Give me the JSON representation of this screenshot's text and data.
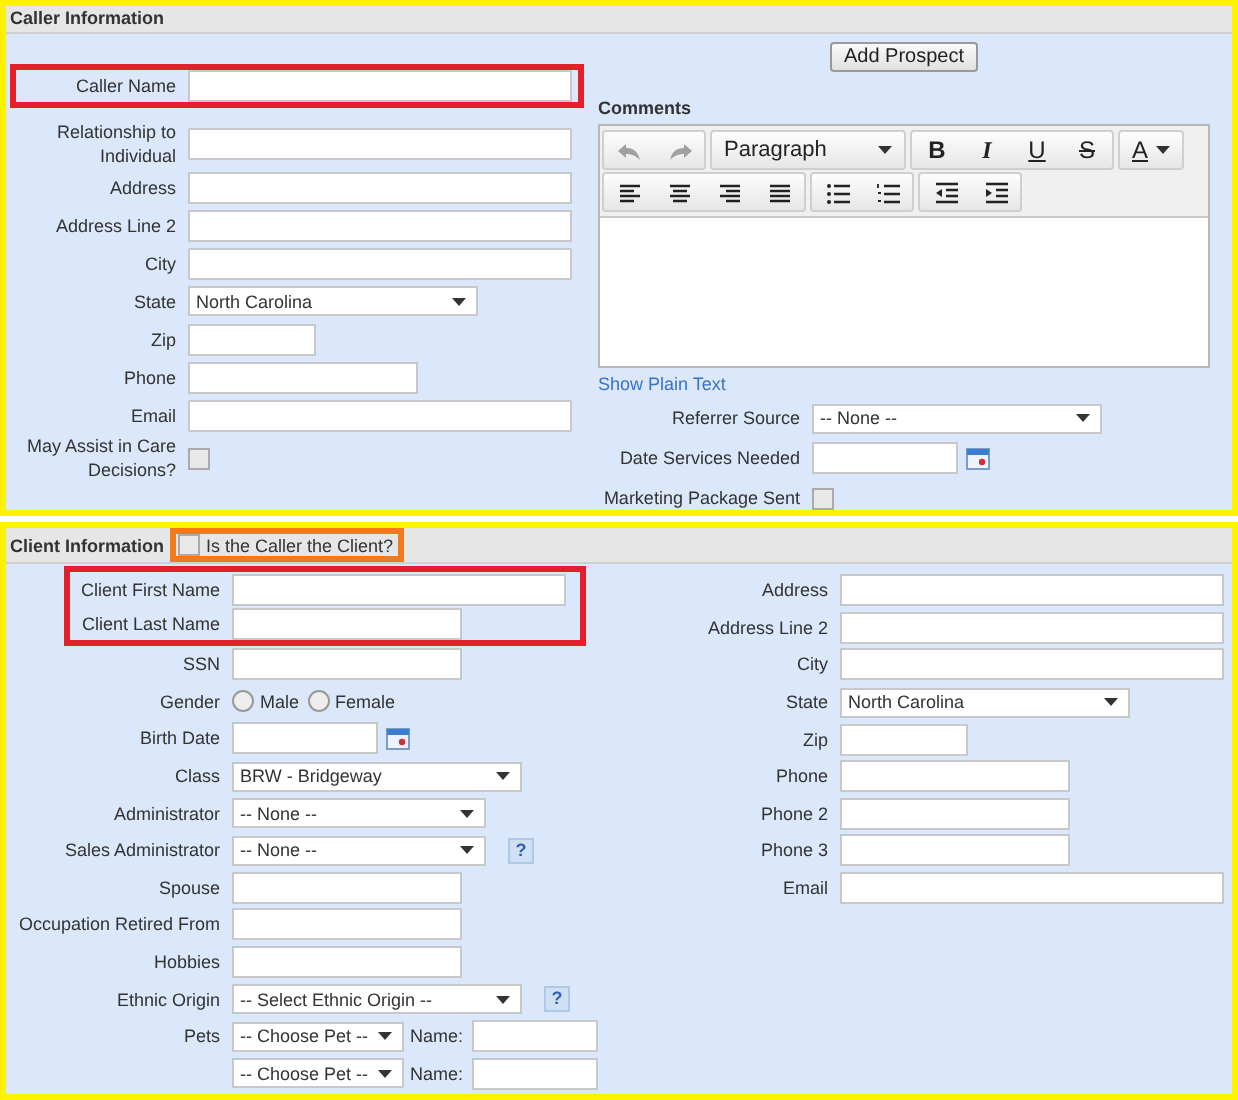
{
  "caller_information": {
    "title": "Caller Information",
    "fields": [
      {
        "kind": "group",
        "color": "#e3202a",
        "fields": [
          {
            "label": "Caller Name",
            "kind": "long"
          }
        ]
      },
      {
        "label": "Relationship to Individual",
        "kind": "long"
      },
      {
        "label": "Address",
        "kind": "long"
      },
      {
        "label": "Address Line 2",
        "kind": "long"
      },
      {
        "label": "City",
        "kind": "long"
      },
      {
        "label": "State",
        "kind": "select",
        "value": "North Carolina"
      },
      {
        "label": "Zip",
        "kind": "short"
      },
      {
        "label": "Phone",
        "kind": "text"
      },
      {
        "label": "Email",
        "kind": "long"
      },
      {
        "label": "May Assist in Care Decisions?",
        "kind": "checkbox",
        "checked": false
      }
    ],
    "add_button": "Add Prospect",
    "comments": {
      "label": "Comments",
      "toolbar_rows": [
        [
          [
            {
              "kind": "undo",
              "disabled": true
            },
            {
              "kind": "redo",
              "disabled": true
            }
          ],
          [
            {
              "kind": "format",
              "text": "Paragraph",
              "disabled": false
            }
          ],
          [
            {
              "kind": "bold",
              "text": "B",
              "disabled": false
            },
            {
              "kind": "italic",
              "text": "I",
              "disabled": false
            },
            {
              "kind": "underline",
              "text": "U",
              "disabled": false
            },
            {
              "kind": "strike",
              "text": "S",
              "disabled": false
            }
          ],
          [
            {
              "kind": "color",
              "text": "A",
              "disabled": false
            }
          ]
        ],
        [
          [
            {
              "kind": "align_left",
              "disabled": false
            },
            {
              "kind": "align_center",
              "disabled": false
            },
            {
              "kind": "align_right",
              "disabled": false
            },
            {
              "kind": "justify",
              "disabled": false
            }
          ],
          [
            {
              "kind": "bullets",
              "disabled": false
            },
            {
              "kind": "numbers",
              "disabled": false
            }
          ],
          [
            {
              "kind": "outdent",
              "disabled": false
            },
            {
              "kind": "indent",
              "disabled": false
            }
          ]
        ]
      ],
      "link": "Show Plain Text"
    },
    "more_fields": [
      {
        "label": "Referrer Source",
        "kind": "select",
        "value": "-- None --"
      },
      {
        "label": "Date Services Needed",
        "kind": "date"
      },
      {
        "label": "Marketing Package Sent",
        "kind": "checkbox",
        "checked": false
      }
    ]
  },
  "client_information": {
    "title": "Client Information",
    "caller_is_client": {
      "label": "Is the Caller the Client?",
      "checked": false,
      "color": "#f07a20"
    },
    "left_fields": [
      {
        "kind": "group",
        "color": "#e3202a",
        "fields": [
          {
            "label": "Client First Name",
            "kind": "mid"
          },
          {
            "label": "Client Last Name",
            "kind": "text"
          }
        ]
      },
      {
        "label": "SSN",
        "kind": "text"
      },
      {
        "label": "Gender",
        "kind": "radio",
        "options": [
          {
            "label": "Male",
            "selected": false
          },
          {
            "label": "Female",
            "selected": false
          }
        ]
      },
      {
        "label": "Birth Date",
        "kind": "date"
      },
      {
        "label": "Class",
        "kind": "select",
        "value": "BRW - Bridgeway"
      },
      {
        "label": "Administrator",
        "kind": "menu",
        "value": "-- None --"
      },
      {
        "label": "Sales Administrator",
        "kind": "menu",
        "value": "-- None --",
        "help": "?"
      },
      {
        "label": "Spouse",
        "kind": "text"
      },
      {
        "label": "Occupation Retired From",
        "kind": "text"
      },
      {
        "label": "Hobbies",
        "kind": "text"
      },
      {
        "label": "Ethnic Origin",
        "kind": "select",
        "value": "-- Select Ethnic Origin --",
        "help": "?"
      },
      {
        "label": "Pets",
        "kind": "pet",
        "value": "-- Choose Pet --",
        "name_label": "Name:"
      },
      {
        "kind": "pet",
        "value": "-- Choose Pet --",
        "name_label": "Name:"
      }
    ],
    "right_fields": [
      {
        "label": "Address",
        "kind": "long"
      },
      {
        "label": "Address Line 2",
        "kind": "long"
      },
      {
        "label": "City",
        "kind": "long"
      },
      {
        "label": "State",
        "kind": "select",
        "value": "North Carolina"
      },
      {
        "label": "Zip",
        "kind": "short"
      },
      {
        "label": "Phone",
        "kind": "text"
      },
      {
        "label": "Phone 2",
        "kind": "text"
      },
      {
        "label": "Phone 3",
        "kind": "text"
      },
      {
        "label": "Email",
        "kind": "long"
      }
    ]
  }
}
